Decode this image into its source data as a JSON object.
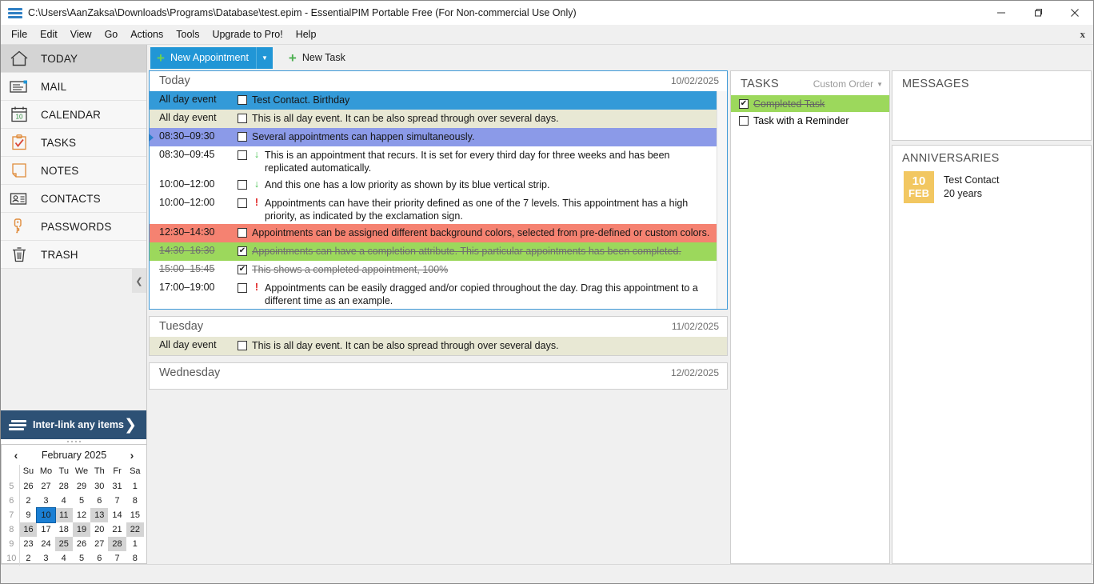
{
  "window": {
    "title": "C:\\Users\\AanZaksa\\Downloads\\Programs\\Database\\test.epim - EssentialPIM Portable Free (For Non-commercial Use Only)",
    "minimize": "—",
    "maximize": "❐",
    "close": "✕"
  },
  "menubar": {
    "items": [
      "File",
      "Edit",
      "View",
      "Go",
      "Actions",
      "Tools",
      "Upgrade to Pro!",
      "Help"
    ],
    "close_label": "x"
  },
  "sidebar": {
    "items": [
      {
        "label": "TODAY",
        "icon": "home-icon",
        "active": true
      },
      {
        "label": "MAIL",
        "icon": "envelope-icon",
        "active": false
      },
      {
        "label": "CALENDAR",
        "icon": "calendar-icon",
        "active": false
      },
      {
        "label": "TASKS",
        "icon": "clipboard-check-icon",
        "active": false
      },
      {
        "label": "NOTES",
        "icon": "note-icon",
        "active": false
      },
      {
        "label": "CONTACTS",
        "icon": "contact-card-icon",
        "active": false
      },
      {
        "label": "PASSWORDS",
        "icon": "key-icon",
        "active": false
      },
      {
        "label": "TRASH",
        "icon": "trash-icon",
        "active": false
      }
    ],
    "collapse_icon": "❮",
    "interlink": {
      "label": "Inter-link any items",
      "arrow": "❯"
    }
  },
  "minicalendar": {
    "prev": "‹",
    "next": "›",
    "month": "February",
    "year": "2025",
    "weekday_headers": [
      "Su",
      "Mo",
      "Tu",
      "We",
      "Th",
      "Fr",
      "Sa"
    ],
    "weeks": [
      {
        "num": "5",
        "days": [
          {
            "d": "26",
            "style": "dimred"
          },
          {
            "d": "27",
            "style": "dim"
          },
          {
            "d": "28",
            "style": "dim"
          },
          {
            "d": "29",
            "style": "dim"
          },
          {
            "d": "30",
            "style": "dim"
          },
          {
            "d": "31",
            "style": "dim"
          },
          {
            "d": "1",
            "style": "red"
          }
        ]
      },
      {
        "num": "6",
        "days": [
          {
            "d": "2",
            "style": "red"
          },
          {
            "d": "3",
            "style": ""
          },
          {
            "d": "4",
            "style": ""
          },
          {
            "d": "5",
            "style": ""
          },
          {
            "d": "6",
            "style": ""
          },
          {
            "d": "7",
            "style": ""
          },
          {
            "d": "8",
            "style": "red"
          }
        ]
      },
      {
        "num": "7",
        "days": [
          {
            "d": "9",
            "style": "red"
          },
          {
            "d": "10",
            "style": "sel"
          },
          {
            "d": "11",
            "style": "hl"
          },
          {
            "d": "12",
            "style": ""
          },
          {
            "d": "13",
            "style": "hl"
          },
          {
            "d": "14",
            "style": ""
          },
          {
            "d": "15",
            "style": "red"
          }
        ]
      },
      {
        "num": "8",
        "days": [
          {
            "d": "16",
            "style": "red hl"
          },
          {
            "d": "17",
            "style": ""
          },
          {
            "d": "18",
            "style": ""
          },
          {
            "d": "19",
            "style": "hl"
          },
          {
            "d": "20",
            "style": ""
          },
          {
            "d": "21",
            "style": ""
          },
          {
            "d": "22",
            "style": "red hl"
          }
        ]
      },
      {
        "num": "9",
        "days": [
          {
            "d": "23",
            "style": "red"
          },
          {
            "d": "24",
            "style": ""
          },
          {
            "d": "25",
            "style": "hl"
          },
          {
            "d": "26",
            "style": ""
          },
          {
            "d": "27",
            "style": ""
          },
          {
            "d": "28",
            "style": "hl"
          },
          {
            "d": "1",
            "style": "dimred"
          }
        ]
      },
      {
        "num": "10",
        "days": [
          {
            "d": "2",
            "style": "dimred"
          },
          {
            "d": "3",
            "style": "dim"
          },
          {
            "d": "4",
            "style": "dim"
          },
          {
            "d": "5",
            "style": "dim"
          },
          {
            "d": "6",
            "style": "dim"
          },
          {
            "d": "7",
            "style": "dim"
          },
          {
            "d": "8",
            "style": "dimred"
          }
        ]
      }
    ]
  },
  "toolbar": {
    "new_appointment": "New Appointment",
    "new_appointment_plus": "+",
    "new_appointment_caret": "▼",
    "new_task": "New Task",
    "new_task_plus": "+"
  },
  "days": [
    {
      "name": "Today",
      "date": "10/02/2025",
      "selected": true,
      "appointments": [
        {
          "time": "All day event",
          "checked": false,
          "priority": "",
          "text": "Test Contact. Birthday",
          "bg": "#339ad8",
          "done": false
        },
        {
          "time": "All day event",
          "checked": false,
          "priority": "",
          "text": "This is all day event. It can be also spread through over several days.",
          "bg": "#e8e8d4",
          "done": false
        },
        {
          "time": "08:30–09:30",
          "checked": false,
          "priority": "",
          "text": "Several appointments can happen simultaneously.",
          "bg": "#8b9ae8",
          "done": false,
          "marker": true
        },
        {
          "time": "08:30–09:45",
          "checked": false,
          "priority": "low",
          "text": "This is an appointment that recurs. It is set for every third day for three weeks and has been replicated automatically.",
          "bg": "#ffffff",
          "done": false
        },
        {
          "time": "10:00–12:00",
          "checked": false,
          "priority": "low",
          "text": "And this one has a low priority as shown by its blue vertical strip.",
          "bg": "#ffffff",
          "done": false
        },
        {
          "time": "10:00–12:00",
          "checked": false,
          "priority": "high",
          "text": "Appointments can have their priority defined as one of the 7 levels. This appointment has a high priority, as indicated by the exclamation sign.",
          "bg": "#ffffff",
          "done": false
        },
        {
          "time": "12:30–14:30",
          "checked": false,
          "priority": "",
          "text": "Appointments can be assigned different background colors, selected from pre-defined or custom colors.",
          "bg": "#f58271",
          "done": false
        },
        {
          "time": "14:30–16:30",
          "checked": true,
          "priority": "",
          "text": "Appointments can have a completion attribute. This particular appointments has been completed.",
          "bg": "#9cd85c",
          "done": true
        },
        {
          "time": "15:00–15:45",
          "checked": true,
          "priority": "",
          "text": "This shows a completed appointment, 100%",
          "bg": "#ffffff",
          "done": true
        },
        {
          "time": "17:00–19:00",
          "checked": false,
          "priority": "high",
          "text": "Appointments can be easily dragged and/or copied throughout the day. Drag this appointment to a different time as an example.",
          "bg": "#fcb濁",
          "done": false
        }
      ]
    },
    {
      "name": "Tuesday",
      "date": "11/02/2025",
      "selected": false,
      "appointments": [
        {
          "time": "All day event",
          "checked": false,
          "priority": "",
          "text": "This is all day event. It can be also spread through over several days.",
          "bg": "#e8e8d4",
          "done": false
        }
      ]
    },
    {
      "name": "Wednesday",
      "date": "12/02/2025",
      "selected": false,
      "appointments": []
    }
  ],
  "tasks_panel": {
    "title": "TASKS",
    "sort_label": "Custom Order",
    "sort_caret": "▼",
    "items": [
      {
        "label": "Completed Task",
        "checked": true,
        "completed": true
      },
      {
        "label": "Task with a Reminder",
        "checked": false,
        "completed": false
      }
    ]
  },
  "messages_panel": {
    "title": "MESSAGES"
  },
  "anniversaries_panel": {
    "title": "ANNIVERSARIES",
    "items": [
      {
        "day": "10",
        "month": "FEB",
        "name": "Test Contact",
        "detail": "20 years"
      }
    ]
  },
  "colors": {
    "accent": "#2196d6",
    "green": "#9cd85c",
    "red": "#f58271",
    "orange": "#fcb濁",
    "periwinkle": "#8b9ae8",
    "beige": "#e8e8d4",
    "anniversary": "#f2c761"
  }
}
